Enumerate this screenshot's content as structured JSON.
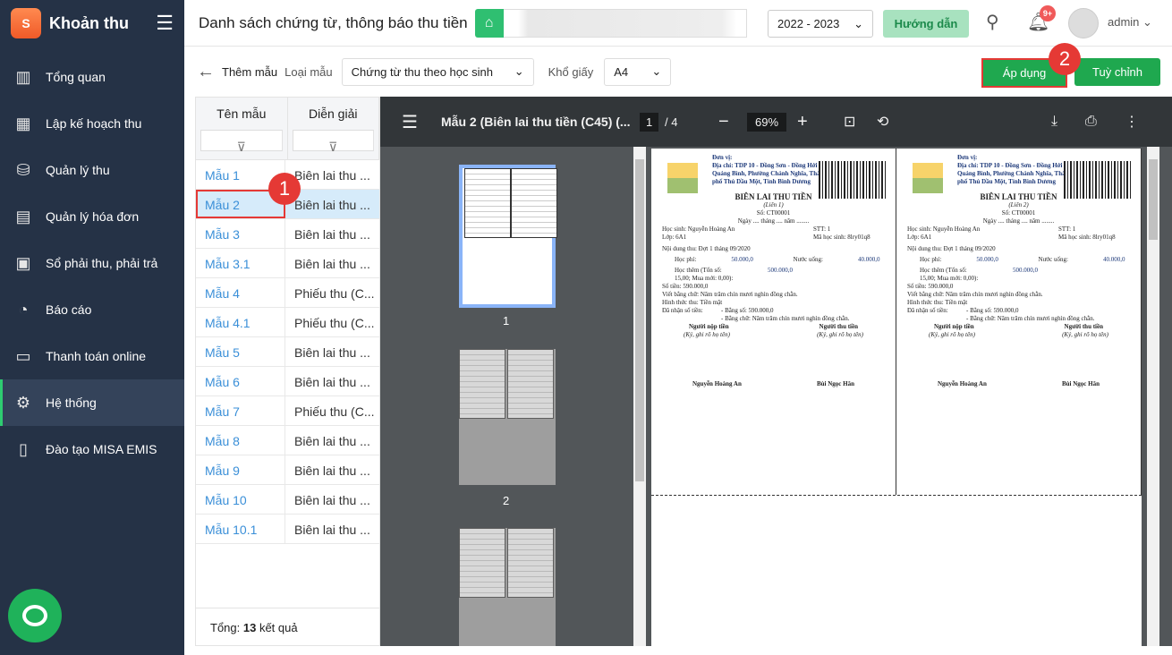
{
  "app": {
    "name": "Khoản thu",
    "logo_text": "S"
  },
  "sidebar": {
    "items": [
      {
        "label": "Tổng quan",
        "icon": "chart-bars-icon",
        "glyph": "▥"
      },
      {
        "label": "Lập kế hoạch thu",
        "icon": "calendar-plan-icon",
        "glyph": "▦"
      },
      {
        "label": "Quản lý thu",
        "icon": "money-hand-icon",
        "glyph": "⛁"
      },
      {
        "label": "Quản lý hóa đơn",
        "icon": "invoice-icon",
        "glyph": "▤"
      },
      {
        "label": "Sổ phải thu, phải trả",
        "icon": "ledger-icon",
        "glyph": "▣"
      },
      {
        "label": "Báo cáo",
        "icon": "pie-chart-icon",
        "glyph": "◔"
      },
      {
        "label": "Thanh toán online",
        "icon": "online-payment-icon",
        "glyph": "▭"
      },
      {
        "label": "Hệ thống",
        "icon": "gear-icon",
        "glyph": "⚙",
        "active": true
      },
      {
        "label": "Đào tạo MISA EMIS",
        "icon": "book-icon",
        "glyph": "▯"
      }
    ]
  },
  "header": {
    "title": "Danh sách chứng từ, thông báo thu tiền",
    "year": "2022 - 2023",
    "guide": "Hướng dẫn",
    "notif_badge": "9+",
    "user": "admin"
  },
  "toolbar": {
    "back_label": "Thêm mẫu",
    "type_label": "Loại mẫu",
    "type_value": "Chứng từ thu theo học sinh",
    "paper_label": "Khổ giấy",
    "paper_value": "A4",
    "apply": "Áp dụng",
    "custom": "Tuỳ chỉnh",
    "step1": "1",
    "step2": "2"
  },
  "table": {
    "headers": [
      "Tên mẫu",
      "Diễn giải"
    ],
    "rows": [
      [
        "Mẫu 1",
        "Biên lai thu ..."
      ],
      [
        "Mẫu 2",
        "Biên lai thu ..."
      ],
      [
        "Mẫu 3",
        "Biên lai thu ..."
      ],
      [
        "Mẫu 3.1",
        "Biên lai thu ..."
      ],
      [
        "Mẫu 4",
        "Phiếu thu (C..."
      ],
      [
        "Mẫu 4.1",
        "Phiếu thu (C..."
      ],
      [
        "Mẫu 5",
        "Biên lai thu ..."
      ],
      [
        "Mẫu 6",
        "Biên lai thu ..."
      ],
      [
        "Mẫu 7",
        "Phiếu thu (C..."
      ],
      [
        "Mẫu 8",
        "Biên lai thu ..."
      ],
      [
        "Mẫu 9",
        "Biên lai thu ..."
      ],
      [
        "Mẫu 10",
        "Biên lai thu ..."
      ],
      [
        "Mẫu 10.1",
        "Biên lai thu ..."
      ]
    ],
    "selected": 1,
    "total_prefix": "Tổng: ",
    "total_count": "13",
    "total_suffix": " kết quả"
  },
  "viewer": {
    "title": "Mẫu 2 (Biên lai thu tiền (C45) (...",
    "page": "1",
    "pages": "/ 4",
    "zoom": "69%",
    "thumb_labels": [
      "1",
      "2"
    ]
  },
  "receipt": {
    "unit": "Đơn vị:",
    "address": "Địa chỉ: TDP 10 - Đồng Sơn - Đồng Hới - Quảng Bình, Phường Chánh Nghĩa, Thành phố Thủ Dầu Một, Tỉnh Bình Dương",
    "heading": "BIÊN LAI THU TIỀN",
    "copies": [
      "(Liên 1)",
      "(Liên 2)"
    ],
    "number": "Số: CT00001",
    "date": "Ngày .... tháng .... năm ........",
    "student": "Học sinh: Nguyễn Hoàng An",
    "stt": "STT: 1",
    "class": "Lớp: 6A1",
    "student_code": "Mã học sinh: 8lry01q8",
    "content": "Nội dung thu: Đợt 1 tháng 09/2020",
    "fee_label": "Học phí:",
    "fee": "50.000,0",
    "water_label": "Nước uống:",
    "water": "40.000,0",
    "extra_label": "Học thêm (Tổn số: 15,00; Mua mới: 0,00):",
    "extra": "500.000,0",
    "amount": "Số tiền: 590.000,0",
    "words": "Viết bằng chữ: Năm trăm chín mươi nghìn đồng chẵn.",
    "method": "Hình thức thu: Tiền mặt",
    "received": "Đã nhận số tiền:",
    "rec_num": "- Bằng số: 590.000,0",
    "rec_words": "- Bằng chữ: Năm trăm chín mươi nghìn đồng chẵn.",
    "payer": "Người nộp tiền",
    "collector": "Người thu tiền",
    "sign_note": "(Ký, ghi rõ họ tên)",
    "payer_name": "Nguyễn Hoàng An",
    "collector_name": "Bùi Ngọc Hân"
  }
}
